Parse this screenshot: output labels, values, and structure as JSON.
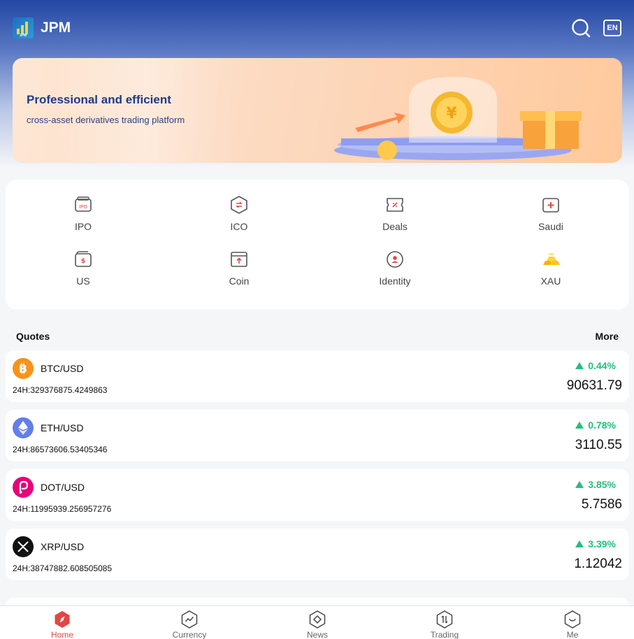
{
  "header": {
    "brand": "JPM",
    "logo_text": "JPM",
    "lang": "EN"
  },
  "banner": {
    "title": "Professional and efficient",
    "subtitle": "cross-asset derivatives trading platform"
  },
  "menu": [
    {
      "label": "IPO",
      "icon": "ipo-icon",
      "icon_text": "IPO"
    },
    {
      "label": "ICO",
      "icon": "ico-hexagon-icon"
    },
    {
      "label": "Deals",
      "icon": "deals-ticket-icon"
    },
    {
      "label": "Saudi",
      "icon": "saudi-plus-icon"
    },
    {
      "label": "US",
      "icon": "us-wallet-icon"
    },
    {
      "label": "Coin",
      "icon": "coin-box-icon"
    },
    {
      "label": "Identity",
      "icon": "identity-icon"
    },
    {
      "label": "XAU",
      "icon": "gold-bars-icon"
    }
  ],
  "quotes": {
    "title": "Quotes",
    "more": "More",
    "items": [
      {
        "pair": "BTC/USD",
        "volume": "24H:329376875.4249863",
        "change": "0.44%",
        "price": "90631.79",
        "icon": "bitcoin-icon",
        "color": "#f7931a"
      },
      {
        "pair": "ETH/USD",
        "volume": "24H:86573606.53405346",
        "change": "0.78%",
        "price": "3110.55",
        "icon": "ethereum-icon",
        "color": "#627eea"
      },
      {
        "pair": "DOT/USD",
        "volume": "24H:11995939.256957276",
        "change": "3.85%",
        "price": "5.7586",
        "icon": "polkadot-icon",
        "color": "#e6007a"
      },
      {
        "pair": "XRP/USD",
        "volume": "24H:38747882.608505085",
        "change": "3.39%",
        "price": "1.12042",
        "icon": "xrp-icon",
        "color": "#111111"
      }
    ]
  },
  "tabs": [
    {
      "label": "Home",
      "icon": "home-compass-icon",
      "active": true
    },
    {
      "label": "Currency",
      "icon": "currency-chart-icon",
      "active": false
    },
    {
      "label": "News",
      "icon": "news-diamond-icon",
      "active": false
    },
    {
      "label": "Trading",
      "icon": "trading-arrows-icon",
      "active": false
    },
    {
      "label": "Me",
      "icon": "me-smile-icon",
      "active": false
    }
  ],
  "colors": {
    "accent_red": "#e54545",
    "up_green": "#22c07a",
    "header_blue": "#2347a3"
  }
}
